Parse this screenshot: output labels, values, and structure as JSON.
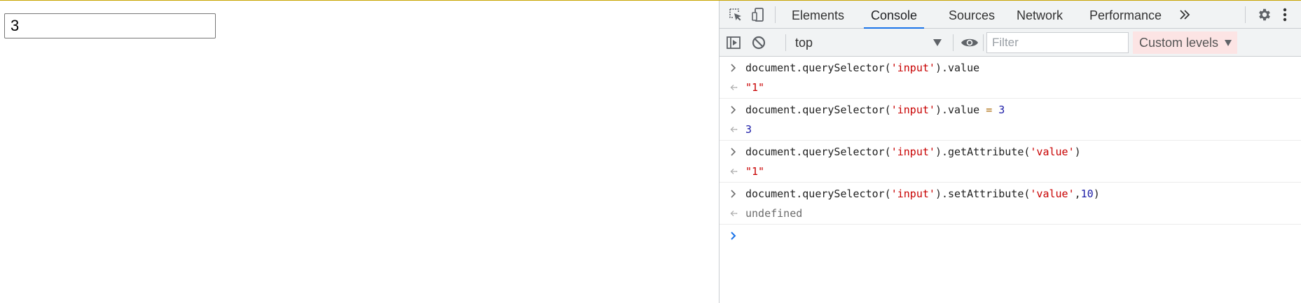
{
  "page": {
    "input_value": "3"
  },
  "devtools": {
    "tabs": [
      {
        "label": "Elements"
      },
      {
        "label": "Console",
        "active": true
      },
      {
        "label": "Sources"
      },
      {
        "label": "Network"
      },
      {
        "label": "Performance"
      }
    ],
    "icons": {
      "inspect": "inspect-element-icon",
      "device": "device-toolbar-icon",
      "more_tabs": "more-tabs-chevron-icon",
      "settings": "gear-icon",
      "kebab": "kebab-menu-icon",
      "sidebar": "show-console-sidebar-icon",
      "clear": "clear-console-icon",
      "eye": "live-expression-eye-icon"
    },
    "toolbar": {
      "context": "top",
      "filter_placeholder": "Filter",
      "levels_label": "Custom levels"
    },
    "colors": {
      "accent": "#1a73e8",
      "string": "#c80000",
      "number": "#1a1aa6",
      "levels_bg": "#fce4e4"
    },
    "console": [
      {
        "input": {
          "pre": "document.querySelector(",
          "str": "'input'",
          "post": ").value"
        },
        "output": {
          "text": "\"1\"",
          "kind": "string"
        }
      },
      {
        "input": {
          "pre": "document.querySelector(",
          "str": "'input'",
          "post": ").value ",
          "op": "=",
          "num": "3"
        },
        "output": {
          "text": "3",
          "kind": "number"
        }
      },
      {
        "input": {
          "pre": "document.querySelector(",
          "str": "'input'",
          "post": ").getAttribute(",
          "str2": "'value'",
          "end": ")"
        },
        "output": {
          "text": "\"1\"",
          "kind": "string"
        }
      },
      {
        "input": {
          "pre": "document.querySelector(",
          "str": "'input'",
          "post": ").setAttribute(",
          "str2": "'value'",
          "comma": ",",
          "num": "10",
          "end": ")"
        },
        "output": {
          "text": "undefined",
          "kind": "undefined"
        }
      }
    ]
  }
}
